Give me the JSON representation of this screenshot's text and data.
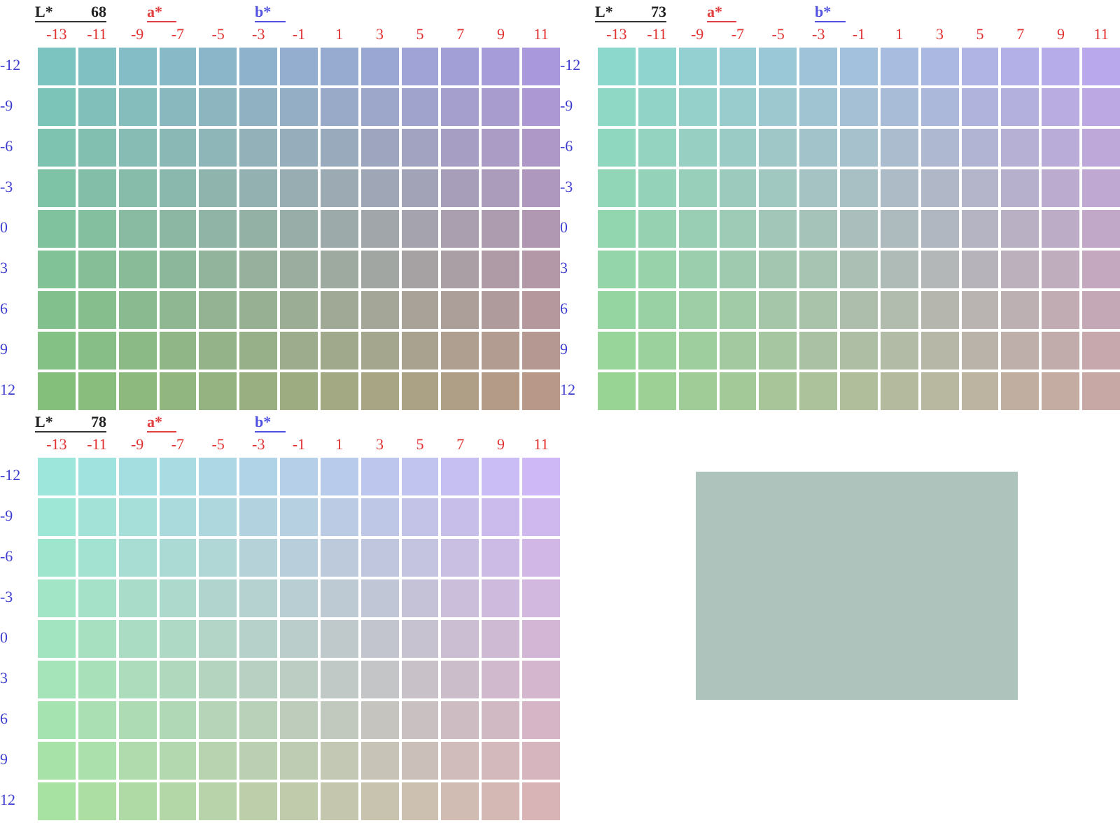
{
  "panels": [
    {
      "l_label": "L*",
      "l_value": "68",
      "a_label": "a*",
      "b_label": "b*",
      "columns": [
        "-13",
        "-11",
        "-9",
        "-7",
        "-5",
        "-3",
        "-1",
        "1",
        "3",
        "5",
        "7",
        "9",
        "11"
      ],
      "rows": [
        "-12",
        "-9",
        "-6",
        "-3",
        "0",
        "3",
        "6",
        "9",
        "12"
      ],
      "corners": [
        {
          "color": "#7cc4c0"
        },
        {
          "color": "#aa98dc"
        },
        {
          "color": "#84c07c"
        },
        {
          "color": "#b89888"
        }
      ]
    },
    {
      "l_label": "L*",
      "l_value": "73",
      "a_label": "a*",
      "b_label": "b*",
      "columns": [
        "-13",
        "-11",
        "-9",
        "-7",
        "-5",
        "-3",
        "-1",
        "1",
        "3",
        "5",
        "7",
        "9",
        "11"
      ],
      "rows": [
        "-12",
        "-9",
        "-6",
        "-3",
        "0",
        "3",
        "6",
        "9",
        "12"
      ],
      "corners": [
        {
          "color": "#8cd8cc"
        },
        {
          "color": "#baa8ec"
        },
        {
          "color": "#98d494"
        },
        {
          "color": "#c8a8a4"
        }
      ]
    },
    {
      "l_label": "L*",
      "l_value": "78",
      "a_label": "a*",
      "b_label": "b*",
      "columns": [
        "-13",
        "-11",
        "-9",
        "-7",
        "-5",
        "-3",
        "-1",
        "1",
        "3",
        "5",
        "7",
        "9",
        "11"
      ],
      "rows": [
        "-12",
        "-9",
        "-6",
        "-3",
        "0",
        "3",
        "6",
        "9",
        "12"
      ],
      "corners": [
        {
          "color": "#9ce6dc"
        },
        {
          "color": "#ceb8f6"
        },
        {
          "color": "#a8e2a2"
        },
        {
          "color": "#d8b4b6"
        }
      ]
    }
  ],
  "sample": {
    "color": "#afc3bd"
  }
}
